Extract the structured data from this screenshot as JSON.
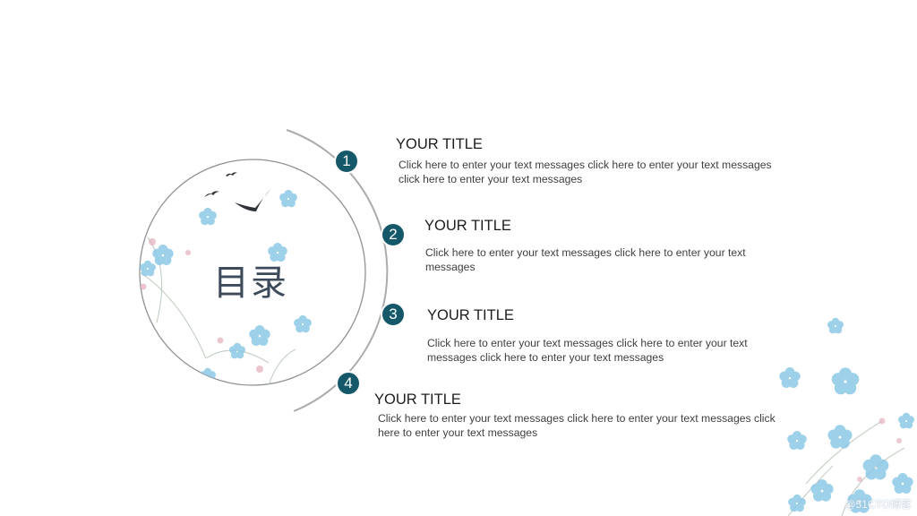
{
  "slide": {
    "circle_title": "目录",
    "watermark": "@51CTO博客"
  },
  "items": [
    {
      "number": "1",
      "title": "YOUR TITLE",
      "body": "Click here to enter your text messages click here to enter your text messages click here to enter your text messages"
    },
    {
      "number": "2",
      "title": "YOUR TITLE",
      "body": "Click here to enter your text messages click here to enter your text messages"
    },
    {
      "number": "3",
      "title": "YOUR TITLE",
      "body": "Click here to enter your text messages click here to enter your text messages click here to enter your text messages"
    },
    {
      "number": "4",
      "title": "YOUR TITLE",
      "body": "Click here to enter your text messages click here to enter your text messages click here to enter your text messages"
    }
  ],
  "colors": {
    "marker": "#14586a",
    "arc": "#a9abae",
    "flower": "#8cc8e6",
    "petal_pink": "#e6b3bf"
  },
  "icons": [
    "bird-silhouette-icon",
    "forget-me-not-flower-icon"
  ]
}
